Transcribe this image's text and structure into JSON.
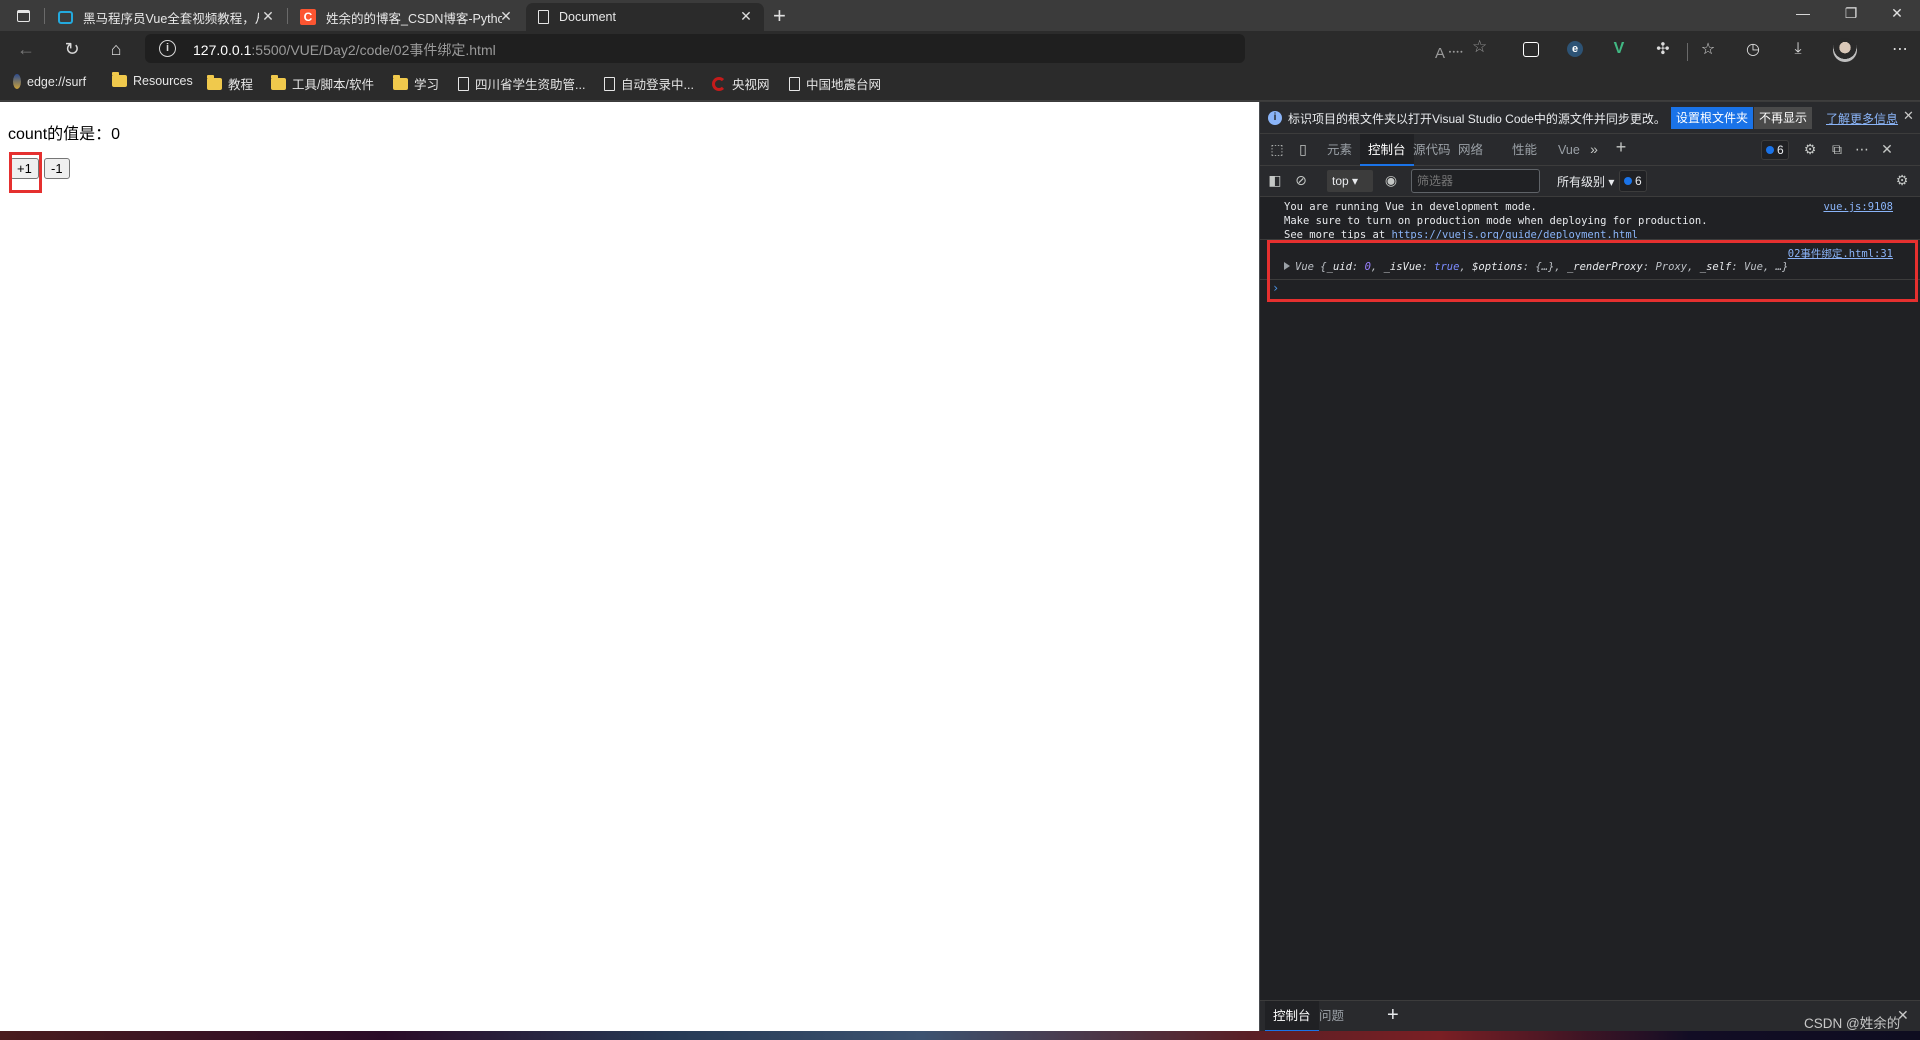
{
  "browser": {
    "tabs": [
      {
        "title": "黑马程序员Vue全套视频教程，从",
        "icon": "bilibili-icon",
        "active": false
      },
      {
        "title": "姓余的的博客_CSDN博客-Python",
        "icon": "csdn-icon",
        "active": false
      },
      {
        "title": "Document",
        "icon": "page-icon",
        "active": true
      }
    ],
    "new_tab_label": "+",
    "window_controls": {
      "minimize": "—",
      "restore": "❐",
      "close": "✕"
    },
    "address": {
      "host": "127.0.0.1",
      "path": ":5500/VUE/Day2/code/02事件绑定.html"
    },
    "bookmarks": [
      {
        "label": "edge://surf",
        "icon": "edge-surf-icon"
      },
      {
        "label": "Resources",
        "icon": "folder-icon"
      },
      {
        "label": "教程",
        "icon": "folder-icon"
      },
      {
        "label": "工具/脚本/软件",
        "icon": "folder-icon"
      },
      {
        "label": "学习",
        "icon": "folder-icon"
      },
      {
        "label": "四川省学生资助管...",
        "icon": "page-icon"
      },
      {
        "label": "自动登录中...",
        "icon": "page-icon"
      },
      {
        "label": "央视网",
        "icon": "cctv-icon"
      },
      {
        "label": "中国地震台网",
        "icon": "page-icon"
      }
    ]
  },
  "page": {
    "count_text": "count的值是：0",
    "buttons": [
      {
        "label": "+1"
      },
      {
        "label": "-1"
      }
    ]
  },
  "devtools": {
    "infobar": {
      "message": "标识项目的根文件夹以打开Visual Studio Code中的源文件并同步更改。",
      "primary_button": "设置根文件夹",
      "secondary_button": "不再显示",
      "learn_more": "了解更多信息",
      "close": "✕"
    },
    "tabs": [
      {
        "label": "元素",
        "active": false
      },
      {
        "label": "控制台",
        "active": true
      },
      {
        "label": "源代码",
        "active": false
      },
      {
        "label": "网络",
        "active": false
      },
      {
        "label": "性能",
        "active": false
      },
      {
        "label": "Vue",
        "active": false
      }
    ],
    "more_tabs": "»",
    "add_tab": "+",
    "issues_count": "6",
    "console_toolbar": {
      "context": "top",
      "filter_placeholder": "筛选器",
      "levels": "所有级别",
      "issues_count": "6"
    },
    "console": {
      "messages": [
        {
          "lines": [
            "You are running Vue in development mode.",
            "Make sure to turn on production mode when deploying for production.",
            "See more tips at "
          ],
          "link": "https://vuejs.org/guide/deployment.html",
          "source": "vue.js:9108"
        },
        {
          "source": "02事件绑定.html:31",
          "object": {
            "class_name": "Vue",
            "open": "{",
            "props": [
              {
                "key": "_uid",
                "value": "0",
                "type": "num"
              },
              {
                "key": "_isVue",
                "value": "true",
                "type": "bool"
              },
              {
                "key": "$options",
                "value": "{…}",
                "type": "str"
              },
              {
                "key": "_renderProxy",
                "value": "Proxy",
                "type": "str"
              },
              {
                "key": "_self",
                "value": "Vue",
                "type": "str"
              }
            ],
            "close": "…}"
          }
        }
      ],
      "prompt": "›"
    },
    "drawer": {
      "tabs": [
        {
          "label": "控制台",
          "active": true
        },
        {
          "label": "问题",
          "active": false
        }
      ],
      "add": "+",
      "close": "✕"
    }
  },
  "watermark": "CSDN @姓余的",
  "colors": {
    "highlight_box": "#e5302f",
    "accent_blue": "#1a73e8",
    "link_blue": "#8ab4f8"
  }
}
